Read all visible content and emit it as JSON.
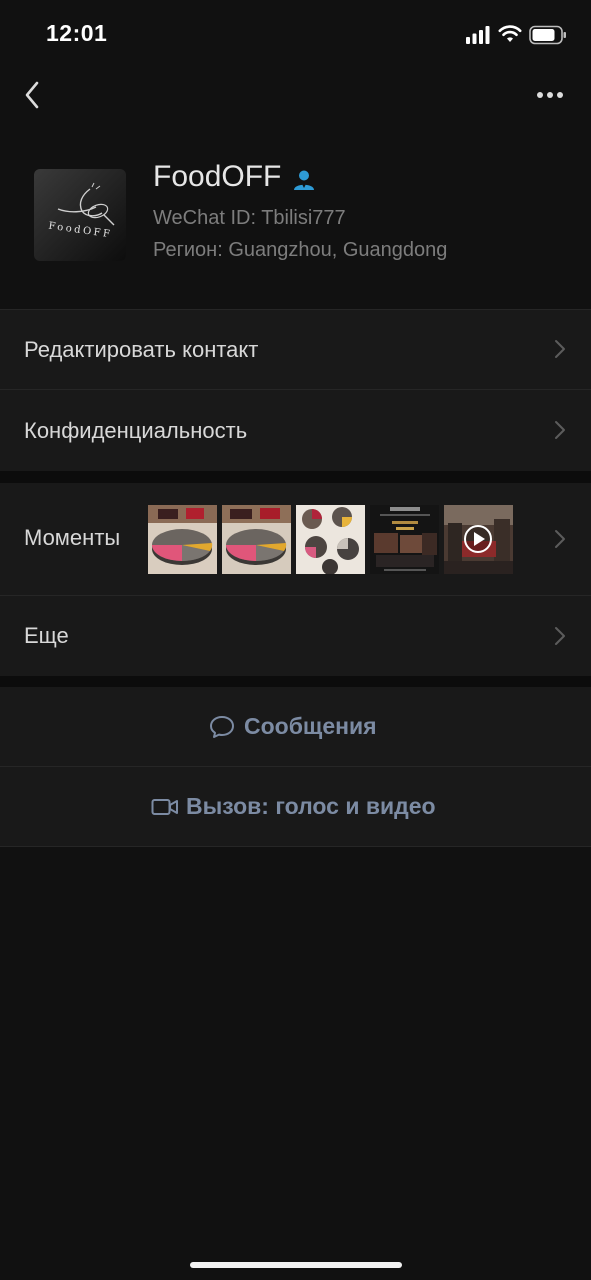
{
  "status_bar": {
    "time": "12:01",
    "icons": [
      "cellular-signal-icon",
      "wifi-icon",
      "battery-icon"
    ]
  },
  "nav": {
    "back_icon": "chevron-left-icon",
    "more_icon": "ellipsis-icon"
  },
  "profile": {
    "avatar_logo_text": "FoodOFF",
    "name": "FoodOFF",
    "verified_icon": "person-badge-icon",
    "wechat_id": "WeChat ID: Tbilisi777",
    "region": "Регион: Guangzhou, Guangdong"
  },
  "menu": {
    "edit_contact": "Редактировать контакт",
    "privacy": "Конфиденциальность",
    "moments": "Моменты",
    "more": "Еще"
  },
  "actions": {
    "messages": "Сообщения",
    "messages_icon": "chat-bubble-icon",
    "call": "Вызов: голос и видео",
    "call_icon": "video-camera-icon"
  },
  "colors": {
    "background": "#111111",
    "row_background": "#191919",
    "action_text": "#7c8ba3",
    "verified_badge": "#2e9bd6"
  }
}
